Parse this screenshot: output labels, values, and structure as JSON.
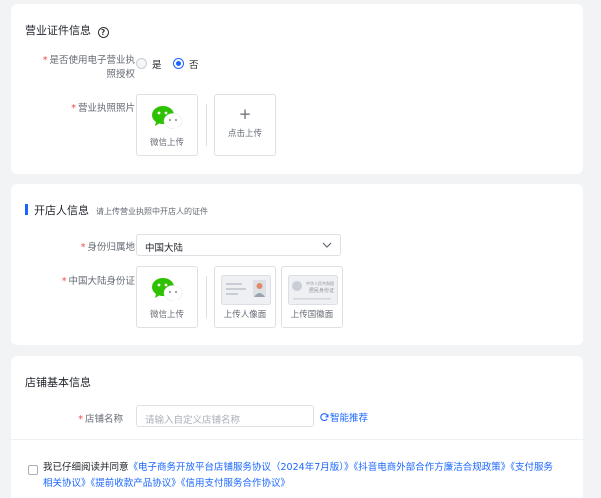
{
  "section1": {
    "title": "营业证件信息",
    "help_icon": "question-circle-icon",
    "field_e_license_label_line1": "是否使用电子营业执",
    "field_e_license_label_line2": "照授权",
    "option_yes": "是",
    "option_no": "否",
    "selected": "否",
    "license_photo_label": "营业执照照片",
    "wechat_upload": "微信上传",
    "click_upload": "点击上传",
    "plus_icon": "+"
  },
  "section2": {
    "title": "开店人信息",
    "subtitle": "请上传营业执照中开店人的证件",
    "id_region_label": "身份归属地",
    "id_region_value": "中国大陆",
    "id_card_label": "中国大陆身份证",
    "wechat_upload": "微信上传",
    "upload_portrait": "上传人像面",
    "upload_emblem": "上传国徽面",
    "card_emblem_text_1": "中华人民共和国",
    "card_emblem_text_2": "居民身份证"
  },
  "section3": {
    "title": "店铺基本信息",
    "shop_name_label": "店铺名称",
    "shop_name_placeholder": "请输入自定义店铺名称",
    "smart_recommend": "智能推荐"
  },
  "agreement": {
    "prefix": "我已仔细阅读并同意",
    "doc1": "《电子商务开放平台店铺服务协议（2024年7月版）》",
    "doc2": "《抖音电商外部合作方廉洁合规政策》",
    "doc3_part1": "《支付服务",
    "doc3_part2": "相关协议》",
    "doc4": "《提前收款产品协议》",
    "doc5": "《信用支付服务合作协议》"
  },
  "colors": {
    "accent": "#1966ff",
    "required": "#f54a45",
    "wechat_green": "#2dc100",
    "background": "#f2f3f5"
  }
}
